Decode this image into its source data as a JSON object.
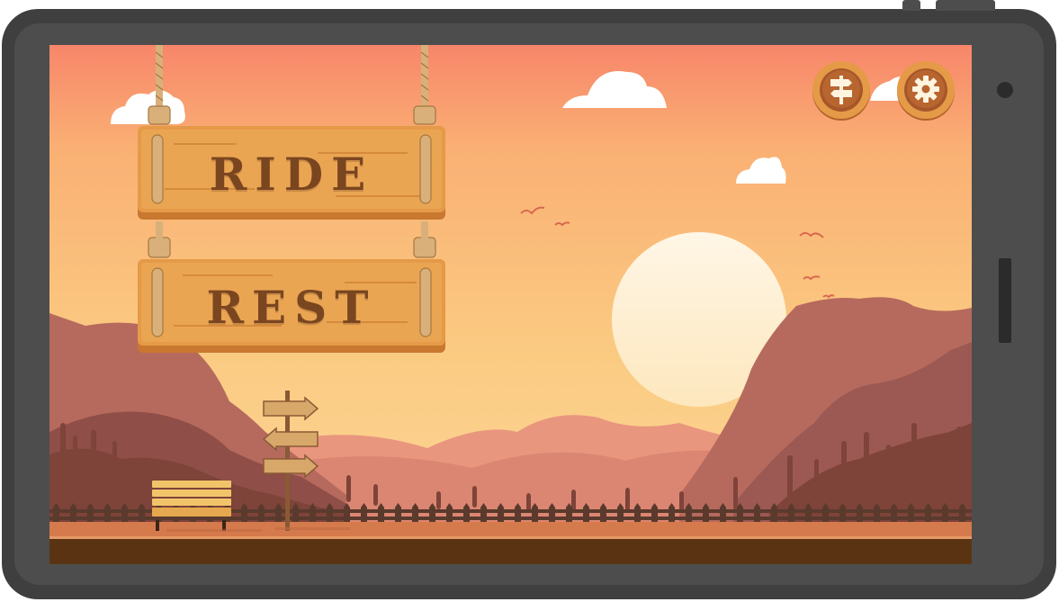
{
  "menu": {
    "ride_label": "RIDE",
    "rest_label": "REST"
  },
  "icons": {
    "map": "signpost-icon",
    "settings": "gear-icon"
  },
  "colors": {
    "sky_top": "#f7876a",
    "sky_bottom": "#fcd393",
    "sun": "#fff1d6",
    "wood": "#e59a47",
    "wood_text": "#7a4620",
    "ground": "#d57a4c",
    "soil": "#5a3412",
    "device": "#3f3f3f"
  }
}
